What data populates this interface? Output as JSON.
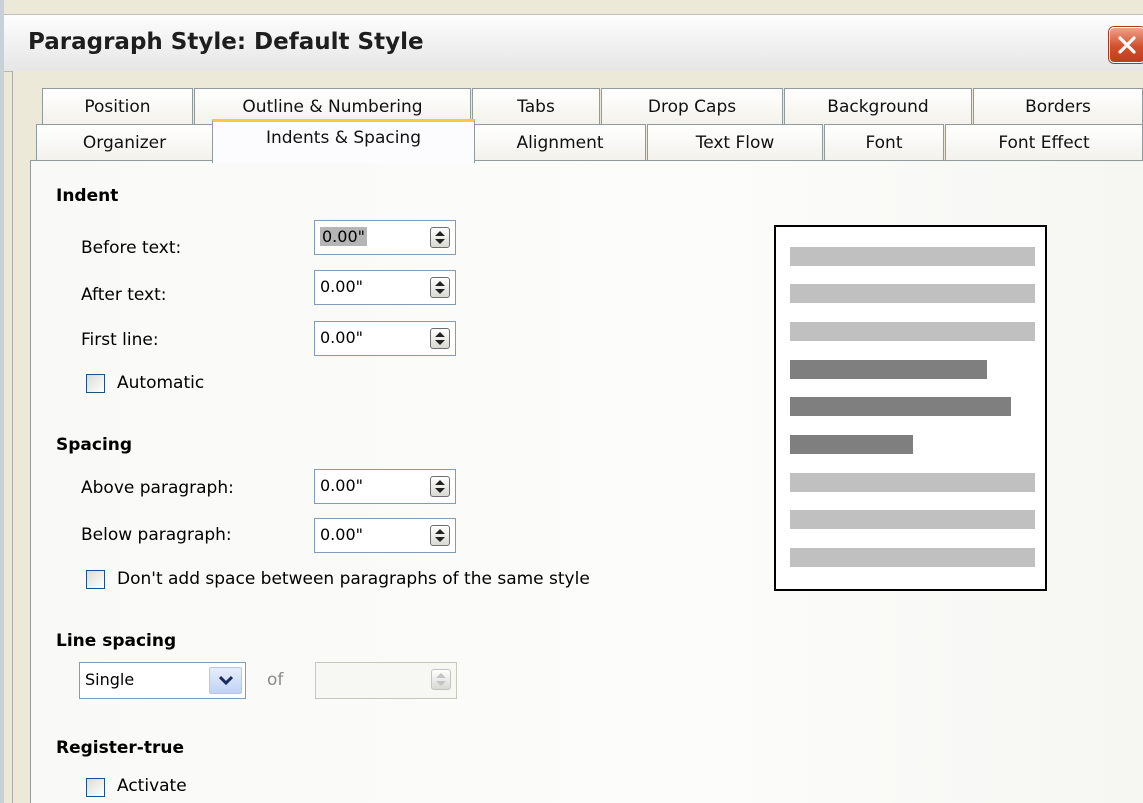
{
  "window": {
    "title": "Paragraph Style: Default Style"
  },
  "tabs": {
    "row1": [
      "Position",
      "Outline & Numbering",
      "Tabs",
      "Drop Caps",
      "Background",
      "Borders"
    ],
    "row2": [
      "Organizer",
      "Indents & Spacing",
      "Alignment",
      "Text Flow",
      "Font",
      "Font Effect"
    ],
    "active": "Indents & Spacing"
  },
  "indent": {
    "heading": "Indent",
    "before_text": {
      "label": "Before text:",
      "value": "0.00\""
    },
    "after_text": {
      "label": "After text:",
      "value": "0.00\""
    },
    "first_line": {
      "label": "First line:",
      "value": "0.00\""
    },
    "automatic": {
      "label": "Automatic",
      "checked": false
    }
  },
  "spacing": {
    "heading": "Spacing",
    "above": {
      "label": "Above paragraph:",
      "value": "0.00\""
    },
    "below": {
      "label": "Below paragraph:",
      "value": "0.00\""
    },
    "no_space": {
      "label": "Don't add space between paragraphs of the same style",
      "checked": false
    }
  },
  "line_spacing": {
    "heading": "Line spacing",
    "mode": "Single",
    "of_label": "of",
    "of_value": ""
  },
  "register_true": {
    "heading": "Register-true",
    "activate": {
      "label": "Activate",
      "checked": false
    }
  },
  "colors": {
    "preview_light": "#c0c0c0",
    "preview_dark": "#7f7f7f",
    "tab_highlight": "#ffc83c",
    "close_button": "#d0502c"
  },
  "icons": [
    "close-icon",
    "spin-up-down-icon",
    "dropdown-chevron-icon"
  ]
}
